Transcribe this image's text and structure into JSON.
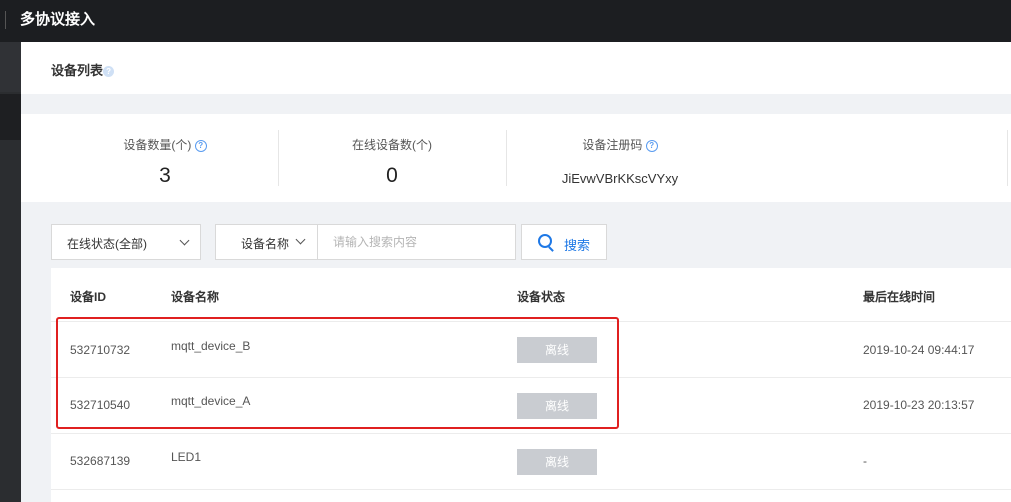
{
  "topbar": {
    "title": "多协议接入"
  },
  "page": {
    "title": "设备列表"
  },
  "stats": [
    {
      "label": "设备数量(个)",
      "value": "3",
      "has_help": true
    },
    {
      "label": "在线设备数(个)",
      "value": "0",
      "has_help": false
    },
    {
      "label": "设备注册码",
      "value": "JiEvwVBrKKscVYxy",
      "has_help": true
    }
  ],
  "filters": {
    "status_select": "在线状态(全部)",
    "field_select": "设备名称",
    "search_placeholder": "请输入搜索内容",
    "search_button": "搜索"
  },
  "table": {
    "columns": [
      "设备ID",
      "设备名称",
      "设备状态",
      "最后在线时间"
    ],
    "rows": [
      {
        "id": "532710732",
        "name": "mqtt_device_B",
        "status": "离线",
        "last_online": "2019-10-24 09:44:17"
      },
      {
        "id": "532710540",
        "name": "mqtt_device_A",
        "status": "离线",
        "last_online": "2019-10-23 20:13:57"
      },
      {
        "id": "532687139",
        "name": "LED1",
        "status": "离线",
        "last_online": "-"
      }
    ]
  },
  "colors": {
    "topbar": "#1c1e21",
    "accent": "#1e78e6",
    "offline_badge": "#c9ccd1",
    "highlight": "#e02020"
  }
}
